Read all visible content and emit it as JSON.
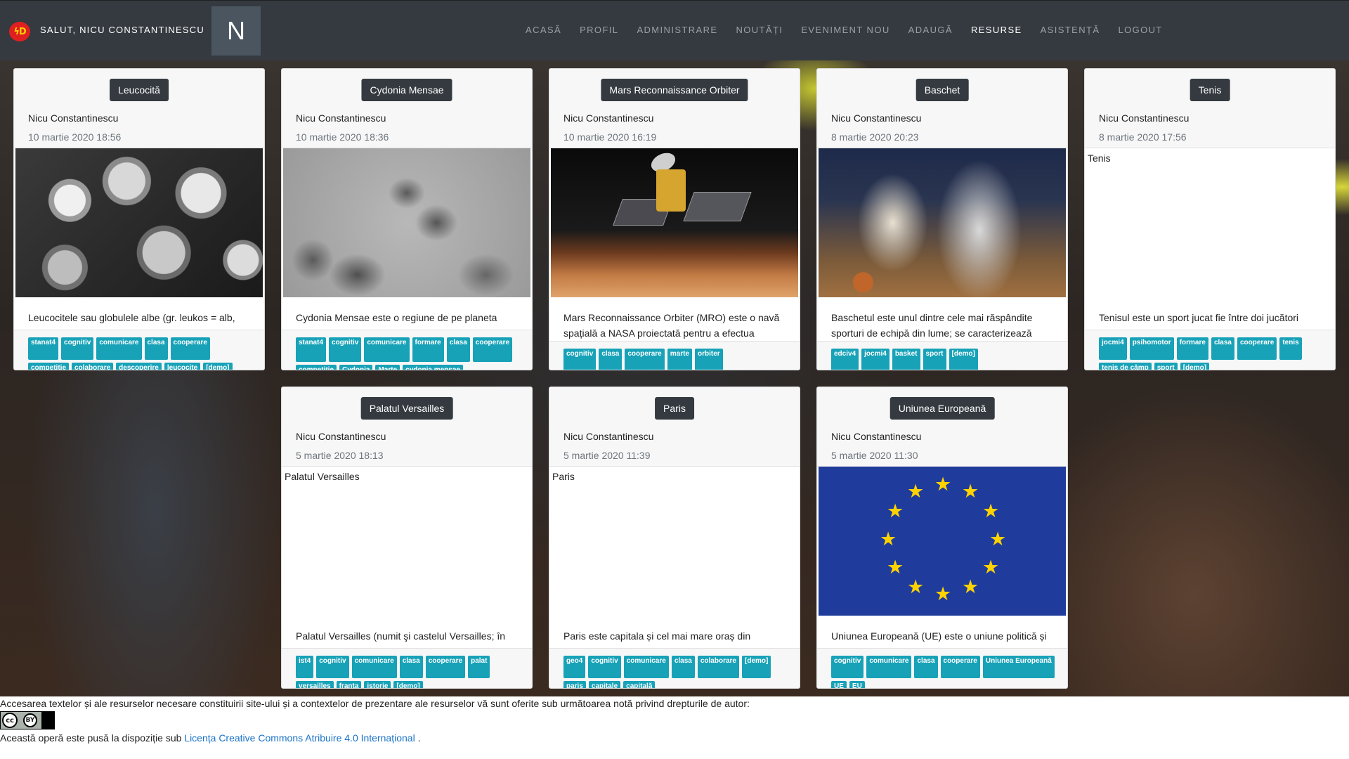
{
  "header": {
    "logo_text": "ϟD",
    "greeting": "SALUT, NICU CONSTANTINESCU",
    "avatar_letter": "N",
    "nav": [
      {
        "label": "ACASĂ",
        "active": false
      },
      {
        "label": "PROFIL",
        "active": false
      },
      {
        "label": "ADMINISTRARE",
        "active": false
      },
      {
        "label": "NOUTĂȚI",
        "active": false
      },
      {
        "label": "EVENIMENT NOU",
        "active": false
      },
      {
        "label": "ADAUGĂ",
        "active": false
      },
      {
        "label": "RESURSE",
        "active": true
      },
      {
        "label": "ASISTENȚĂ",
        "active": false
      },
      {
        "label": "LOGOUT",
        "active": false
      }
    ]
  },
  "cards": [
    {
      "title": "Leucocită",
      "author": "Nicu Constantinescu",
      "date": "10 martie 2020 18:56",
      "description": "Leucocitele sau globulele albe (gr. leukos = alb,",
      "tags": [
        "stanat4",
        "cognitiv",
        "comunicare",
        "clasa",
        "cooperare",
        "competitie",
        "colaborare",
        "descoperire",
        "leucocite",
        "[demo]"
      ]
    },
    {
      "title": "Cydonia Mensae",
      "author": "Nicu Constantinescu",
      "date": "10 martie 2020 18:36",
      "description": "Cydonia Mensae este o regiune de pe planeta",
      "tags": [
        "stanat4",
        "cognitiv",
        "comunicare",
        "formare",
        "clasa",
        "cooperare",
        "competitie",
        "Cydonia",
        "Marte",
        "cydonia mensae"
      ]
    },
    {
      "title": "Mars Reconnaissance Orbiter",
      "author": "Nicu Constantinescu",
      "date": "10 martie 2020 16:19",
      "description": "Mars Reconnaissance Orbiter (MRO) este o navă spațială a NASA proiectată pentru a efectua",
      "tags": [
        "cognitiv",
        "clasa",
        "cooperare",
        "marte",
        "orbiter"
      ]
    },
    {
      "title": "Baschet",
      "author": "Nicu Constantinescu",
      "date": "8 martie 2020 20:23",
      "description": "Baschetul este unul dintre cele mai răspândite sporturi de echipă din lume; se caracterizează",
      "tags": [
        "edciv4",
        "jocmi4",
        "basket",
        "sport",
        "[demo]"
      ]
    },
    {
      "title": "Tenis",
      "author": "Nicu Constantinescu",
      "date": "8 martie 2020 17:56",
      "image_alt": "Tenis",
      "description": "Tenisul este un sport jucat fie între doi jucători",
      "tags": [
        "jocmi4",
        "psihomotor",
        "formare",
        "clasa",
        "cooperare",
        "tenis",
        "tenis de câmp",
        "sport",
        "[demo]"
      ]
    },
    {
      "title": "Palatul Versailles",
      "author": "Nicu Constantinescu",
      "date": "5 martie 2020 18:13",
      "image_alt": "Palatul Versailles",
      "description": "Palatul Versailles (numit şi castelul Versailles; în",
      "tags": [
        "ist4",
        "cognitiv",
        "comunicare",
        "clasa",
        "cooperare",
        "palat",
        "versailles",
        "franța",
        "istorie",
        "[demo]"
      ]
    },
    {
      "title": "Paris",
      "author": "Nicu Constantinescu",
      "date": "5 martie 2020 11:39",
      "image_alt": "Paris",
      "description": "Paris este capitala și cel mai mare oraș din",
      "tags": [
        "geo4",
        "cognitiv",
        "comunicare",
        "clasa",
        "colaborare",
        "[demo]",
        "paris",
        "capitale",
        "capitală"
      ]
    },
    {
      "title": "Uniunea Europeană",
      "author": "Nicu Constantinescu",
      "date": "5 martie 2020 11:30",
      "description": "Uniunea Europeană (UE) este o uniune politică și",
      "tags": [
        "cognitiv",
        "comunicare",
        "clasa",
        "cooperare",
        "Uniunea Europeană",
        "UE",
        "EU"
      ]
    }
  ],
  "footer": {
    "notice": "Accesarea textelor și ale resurselor necesare constituirii site-ului și a contextelor de prezentare ale resurselor vă sunt oferite sub următoarea notă privind drepturile de autor:",
    "license_prefix": "Această operă este pusă la dispoziție sub",
    "license_link": "Licența Creative Commons Atribuire 4.0 Internațional",
    "license_suffix": ".",
    "badge_cc": "cc",
    "badge_by": "BY"
  },
  "colors": {
    "navbar": "#343a40",
    "tag": "#17a2b8",
    "link": "#1a73c8",
    "eu_blue": "#1f3c9c",
    "eu_star": "#ffd200"
  }
}
